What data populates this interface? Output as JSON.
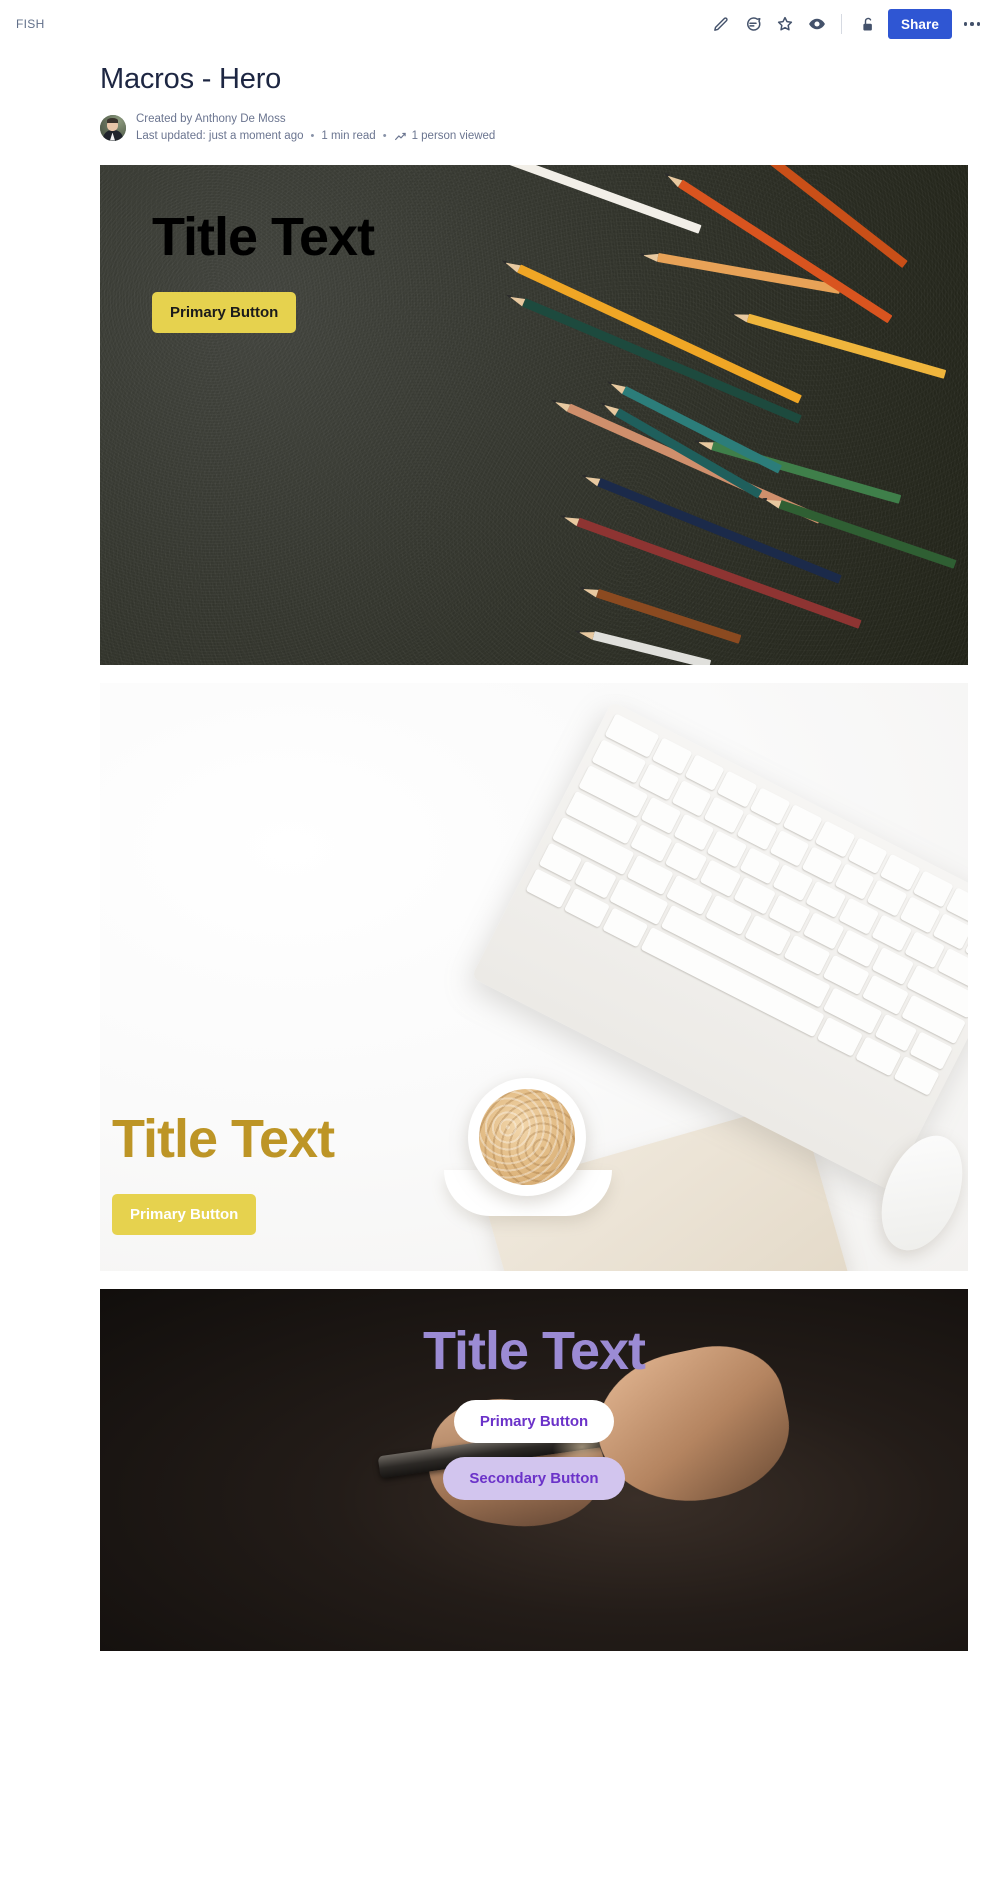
{
  "topbar": {
    "breadcrumb": "FISH",
    "icons": [
      {
        "name": "edit-pencil-icon",
        "label": "Edit"
      },
      {
        "name": "comment-icon",
        "label": "Comment"
      },
      {
        "name": "star-icon",
        "label": "Watch"
      },
      {
        "name": "eye-icon",
        "label": "View"
      },
      {
        "name": "unlock-icon",
        "label": "Restrictions"
      }
    ],
    "share_label": "Share",
    "more_label": "More actions",
    "share_color": "#2f56d3"
  },
  "document": {
    "title": "Macros - Hero",
    "created_by": "Created by Anthony De Moss",
    "last_updated": "Last updated: just a moment ago",
    "read_time": "1 min read",
    "viewers": "1 person viewed",
    "separator": "•"
  },
  "heroes": [
    {
      "id": "hero-pencils",
      "image_description": "colored pencils scattered on dark textured surface",
      "title": "Title Text",
      "title_color": "#ffffff",
      "primary_button": "Primary Button",
      "primary_button_bg": "#e6d24e",
      "primary_button_color": "#1b1b1b",
      "alignment": "left-top"
    },
    {
      "id": "hero-keyboard",
      "image_description": "white keyboard with coffee cup, notebook and mouse on white desk",
      "title": "Title Text",
      "title_color": "#bd9526",
      "primary_button": "Primary Button",
      "primary_button_bg": "#e6d24e",
      "primary_button_color": "#ffffff",
      "alignment": "left-bottom"
    },
    {
      "id": "hero-phone",
      "image_description": "hands holding a smartphone in dark lighting",
      "title": "Title Text",
      "title_color": "#9b8bd4",
      "primary_button": "Primary Button",
      "primary_button_bg": "#ffffff",
      "primary_button_color": "#6b32c9",
      "secondary_button": "Secondary Button",
      "secondary_button_bg": "#d2c5ee",
      "secondary_button_color": "#6b32c9",
      "alignment": "center-top"
    }
  ]
}
